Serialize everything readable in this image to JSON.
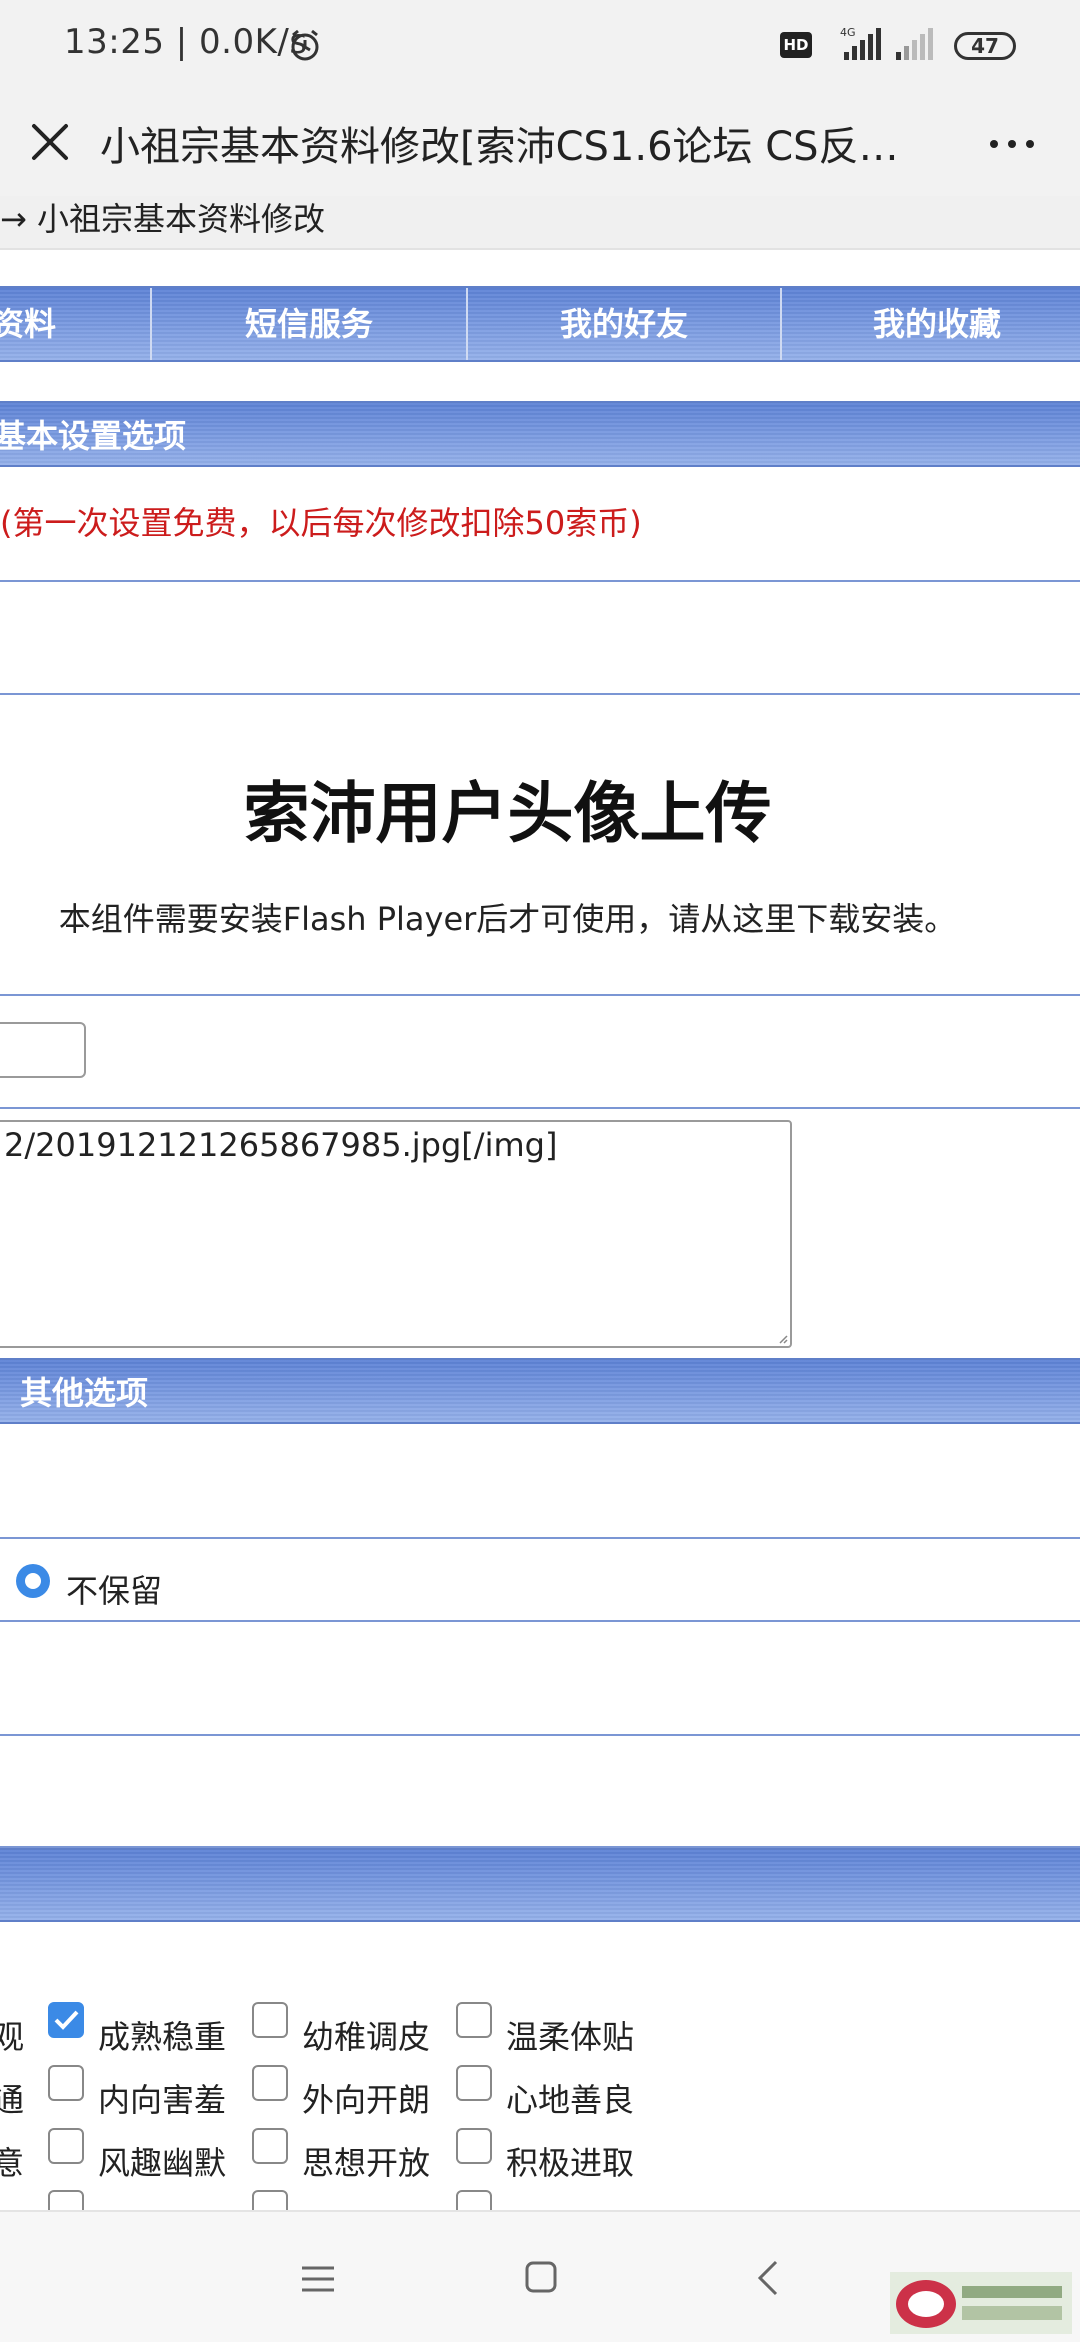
{
  "status_bar": {
    "time": "13:25 | 0.0K/s",
    "hd_label": "HD",
    "network_label": "4G",
    "battery": "47"
  },
  "title_bar": {
    "title": "小祖宗基本资料修改[索沛CS1.6论坛 CS反…"
  },
  "breadcrumb": "→ 小祖宗基本资料修改",
  "nav_tabs": [
    "资料",
    "短信服务",
    "我的好友",
    "我的收藏"
  ],
  "sections": {
    "basic_settings": "基本设置选项",
    "other_options": "其他选项"
  },
  "fee_note": "(第一次设置免费，以后每次修改扣除50索币)",
  "avatar_upload": {
    "heading": "索沛用户头像上传",
    "flash_note": "本组件需要安装Flash Player后才可使用，请从这里下载安装。"
  },
  "signature_text": "2/201912121265867985.jpg[/img]",
  "radio_option": {
    "label": "不保留",
    "selected": true
  },
  "personality": {
    "row_labels": [
      "观",
      "通",
      "意"
    ],
    "rows": [
      [
        {
          "label": "成熟稳重",
          "checked": true
        },
        {
          "label": "幼稚调皮",
          "checked": false
        },
        {
          "label": "温柔体贴",
          "checked": false
        }
      ],
      [
        {
          "label": "内向害羞",
          "checked": false
        },
        {
          "label": "外向开朗",
          "checked": false
        },
        {
          "label": "心地善良",
          "checked": false
        }
      ],
      [
        {
          "label": "风趣幽默",
          "checked": false
        },
        {
          "label": "思想开放",
          "checked": false
        },
        {
          "label": "积极进取",
          "checked": false
        }
      ]
    ]
  },
  "colors": {
    "header_blue": "#5d82d6",
    "fee_red": "#cc1c1c",
    "checkbox_blue": "#3b8ae6"
  }
}
